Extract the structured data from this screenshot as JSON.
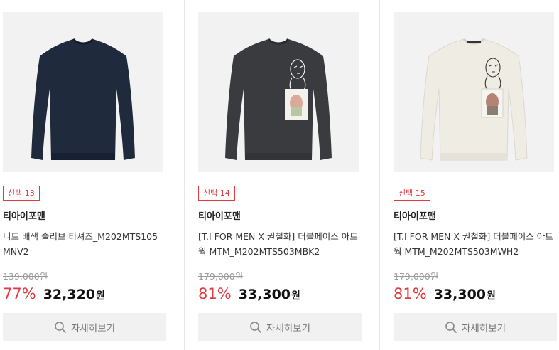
{
  "products": [
    {
      "badge": "선택 13",
      "brand": "티아이포맨",
      "name": "니트 배색 슬리브 티셔즈_M202MTS105MNV2",
      "original_price": "139,000원",
      "discount_rate": "77%",
      "sale_price": "32,320",
      "currency": "원",
      "detail_label": "자세히보기",
      "image": "navy-knit-sweater",
      "color": "#1f2a3c"
    },
    {
      "badge": "선택 14",
      "brand": "티아이포맨",
      "name": "[T.I FOR MEN X 권철화] 더블페이스 아트웍 MTM_M202MTS503MBK2",
      "original_price": "179,000원",
      "discount_rate": "81%",
      "sale_price": "33,300",
      "currency": "원",
      "detail_label": "자세히보기",
      "image": "charcoal-artwork-sweatshirt",
      "color": "#3a3b3f"
    },
    {
      "badge": "선택 15",
      "brand": "티아이포맨",
      "name": "[T.I FOR MEN X 권철화] 더블페이스 아트웍 MTM_M202MTS503MWH2",
      "original_price": "179,000원",
      "discount_rate": "81%",
      "sale_price": "33,300",
      "currency": "원",
      "detail_label": "자세히보기",
      "image": "ivory-artwork-sweatshirt",
      "color": "#efece4"
    }
  ],
  "colors": {
    "accent": "#e0393e",
    "button_bg": "#f1f1f1"
  },
  "icons": {
    "detail": "search-icon"
  }
}
